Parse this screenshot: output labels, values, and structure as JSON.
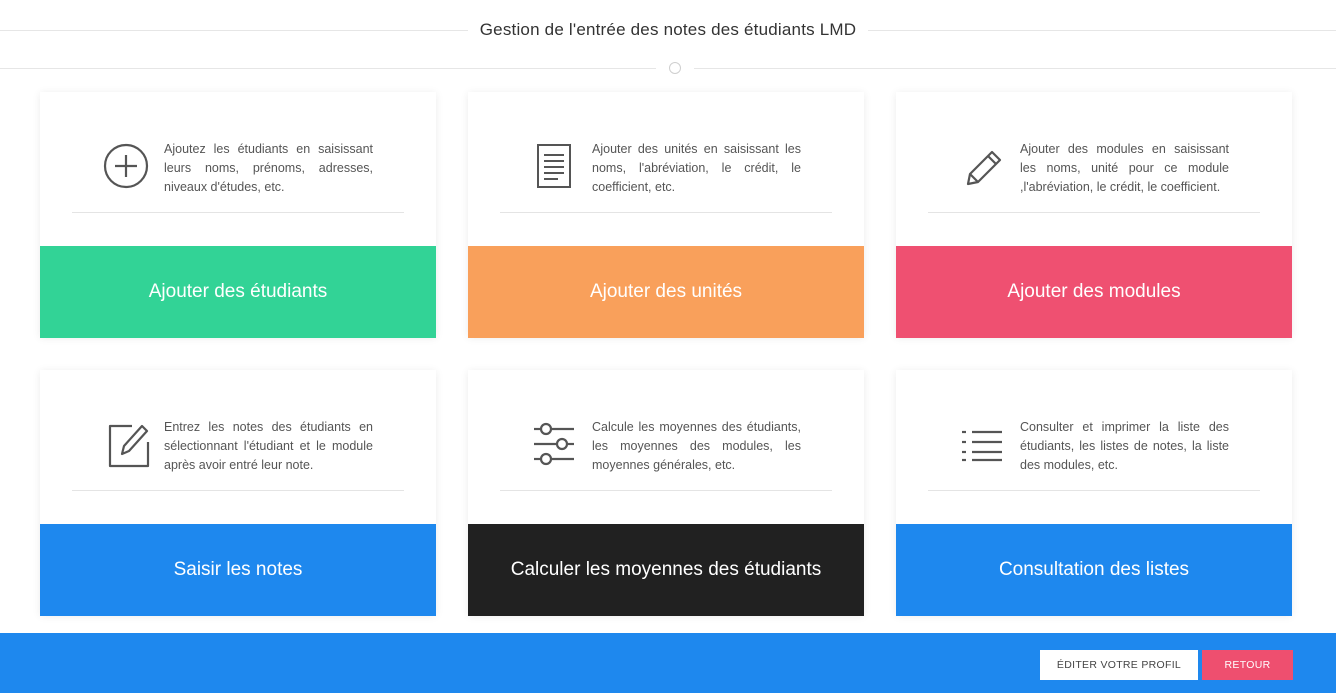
{
  "header": {
    "title": "Gestion de l'entrée des notes des étudiants LMD"
  },
  "cards": [
    {
      "icon": "plus-circle-icon",
      "description": "Ajoutez les étudiants en saisissant leurs noms, prénoms, adresses, niveaux d'études, etc.",
      "button_label": "Ajouter des étudiants",
      "color": "#32d396"
    },
    {
      "icon": "document-icon",
      "description": "Ajouter des unités en saisissant les noms, l'abréviation, le crédit, le coefficient, etc.",
      "button_label": "Ajouter des unités",
      "color": "#f9a05b"
    },
    {
      "icon": "pencil-icon",
      "description": "Ajouter des modules en saisissant les noms, unité pour ce module ,l'abréviation, le crédit, le coefficient.",
      "button_label": "Ajouter des modules",
      "color": "#ef5071"
    },
    {
      "icon": "edit-icon",
      "description": "Entrez les notes des étudiants en sélectionnant l'étudiant et le module après avoir entré leur note.",
      "button_label": "Saisir les notes",
      "color": "#1e88ee"
    },
    {
      "icon": "sliders-icon",
      "description": "Calcule les moyennes des étudiants, les moyennes des modules, les moyennes générales, etc.",
      "button_label": "Calculer les moyennes des étudiants",
      "color": "#212121"
    },
    {
      "icon": "list-icon",
      "description": "Consulter et imprimer la liste des étudiants, les listes de notes, la liste des modules, etc.",
      "button_label": "Consultation des listes",
      "color": "#1e88ee"
    }
  ],
  "footer": {
    "edit_profile_label": "ÉDITER VOTRE PROFIL",
    "back_label": "RETOUR",
    "bar_color": "#1e88ee",
    "back_color": "#ee4f6f"
  }
}
